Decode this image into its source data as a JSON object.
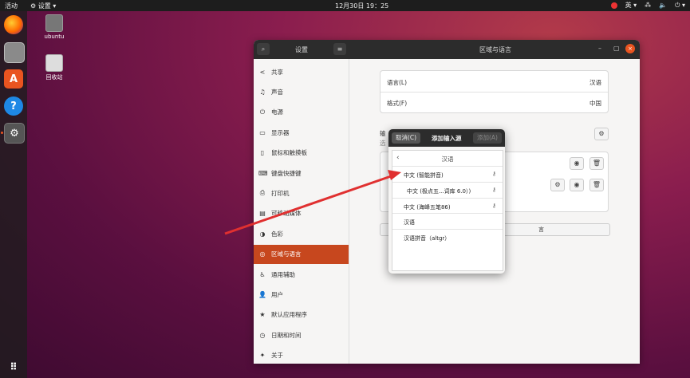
{
  "topbar": {
    "activities": "活动",
    "app_menu": "⚙ 设置 ▾",
    "clock": "12月30日  19：25",
    "input_method": "英 ▾",
    "tray_icons": [
      "stop-icon",
      "network-icon",
      "volume-icon",
      "power-icon"
    ]
  },
  "desktop": {
    "home_label": "ubuntu",
    "trash_label": "回收站"
  },
  "window": {
    "left_title": "设置",
    "title": "区域与语言",
    "min": "–",
    "max": "▢",
    "close": "×"
  },
  "sidebar": {
    "items": [
      {
        "icon": "share-icon",
        "glyph": "<",
        "label": "共享"
      },
      {
        "icon": "music-icon",
        "glyph": "♫",
        "label": "声音"
      },
      {
        "icon": "power-icon",
        "glyph": "⏻",
        "label": "电源"
      },
      {
        "icon": "display-icon",
        "glyph": "▭",
        "label": "显示器"
      },
      {
        "icon": "mouse-icon",
        "glyph": "▯",
        "label": "鼠标和触摸板"
      },
      {
        "icon": "keyboard-icon",
        "glyph": "⌨",
        "label": "键盘快捷键"
      },
      {
        "icon": "printer-icon",
        "glyph": "⎙",
        "label": "打印机"
      },
      {
        "icon": "removable-media-icon",
        "glyph": "▤",
        "label": "可移动媒体"
      },
      {
        "icon": "color-icon",
        "glyph": "◑",
        "label": "色彩"
      },
      {
        "icon": "region-icon",
        "glyph": "◎",
        "label": "区域与语言"
      },
      {
        "icon": "accessibility-icon",
        "glyph": "♿",
        "label": "通用辅助"
      },
      {
        "icon": "users-icon",
        "glyph": "👤",
        "label": "用户"
      },
      {
        "icon": "star-icon",
        "glyph": "★",
        "label": "默认应用程序"
      },
      {
        "icon": "clock-icon",
        "glyph": "◷",
        "label": "日期和时间"
      },
      {
        "icon": "about-icon",
        "glyph": "✦",
        "label": "关于"
      }
    ],
    "active_index": 9
  },
  "region": {
    "language_label": "语言(L)",
    "language_value": "汉语",
    "formats_label": "格式(F)",
    "formats_value": "中国",
    "input_sources_partial": "输",
    "input_sources_desc_partial": "选",
    "add_button_partial": "言"
  },
  "dialog": {
    "cancel": "取消(C)",
    "title": "添加输入源",
    "add": "添加(A)",
    "language": "汉语",
    "items": [
      {
        "label": "中文 (智能拼音)",
        "has_settings": true,
        "indent": false
      },
      {
        "label": "中文 (极点五...词库 6.0）)",
        "has_settings": true,
        "indent": true
      },
      {
        "label": "中文 (海峰五笔86)",
        "has_settings": true,
        "indent": false
      },
      {
        "label": "汉语",
        "has_settings": false,
        "indent": false
      },
      {
        "label": "汉语拼音（altgr）",
        "has_settings": false,
        "indent": false
      }
    ]
  },
  "colors": {
    "accent": "#e95420",
    "sidebar_active": "#c7471e",
    "headerbar": "#2c2c2c",
    "arrow": "#e03030"
  }
}
